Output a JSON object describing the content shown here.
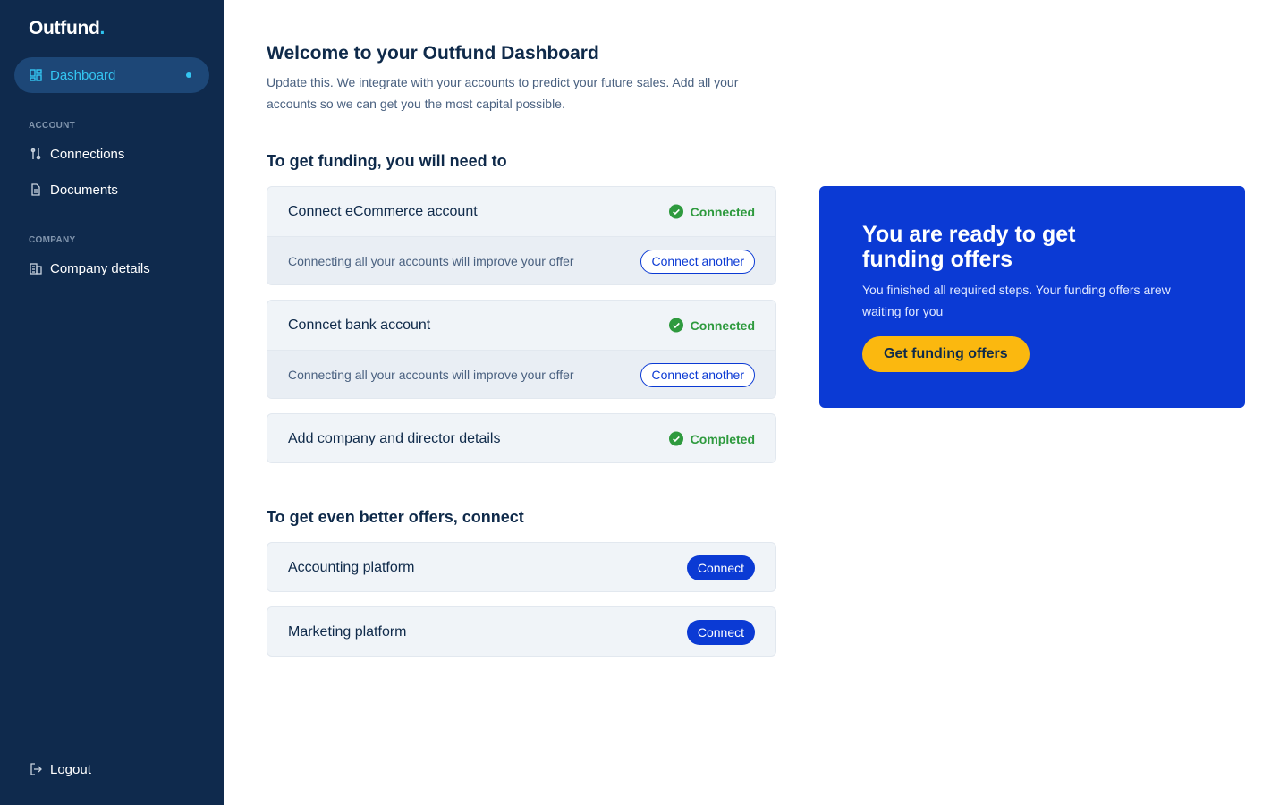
{
  "brand": {
    "name": "Outfund",
    "dot": "."
  },
  "sidebar": {
    "active": {
      "label": "Dashboard",
      "icon": "dashboard-icon"
    },
    "sections": [
      {
        "label": "ACCOUNT",
        "items": [
          {
            "label": "Connections",
            "icon": "connections-icon"
          },
          {
            "label": "Documents",
            "icon": "document-icon"
          }
        ]
      },
      {
        "label": "COMPANY",
        "items": [
          {
            "label": "Company details",
            "icon": "building-icon"
          }
        ]
      }
    ],
    "logout": {
      "label": "Logout",
      "icon": "logout-icon"
    }
  },
  "main": {
    "title": "Welcome to your Outfund Dashboard",
    "subtitle": "Update this. We integrate with your accounts to predict your future sales. Add all your accounts so we can get you the most capital possible.",
    "required_heading": "To get funding, you will need to",
    "required_steps": [
      {
        "title": "Connect eCommerce account",
        "status": "Connected",
        "note": "Connecting all your accounts will improve your offer",
        "action": "Connect another"
      },
      {
        "title": "Conncet bank account",
        "status": "Connected",
        "note": "Connecting all your accounts will improve your offer",
        "action": "Connect another"
      },
      {
        "title": "Add company and director details",
        "status": "Completed"
      }
    ],
    "optional_heading": "To get even better offers, connect",
    "optional_steps": [
      {
        "title": "Accounting platform",
        "action": "Connect"
      },
      {
        "title": "Marketing platform",
        "action": "Connect"
      }
    ]
  },
  "promo": {
    "title": "You are ready to get funding offers",
    "text": "You finished all required steps. Your funding offers arew waiting for you",
    "button": "Get funding offers"
  },
  "colors": {
    "sidebar_bg": "#0f2a4d",
    "accent": "#0b3ad4",
    "active_text": "#34c6f2",
    "success": "#2e9a3e",
    "cta": "#fbb80f"
  }
}
